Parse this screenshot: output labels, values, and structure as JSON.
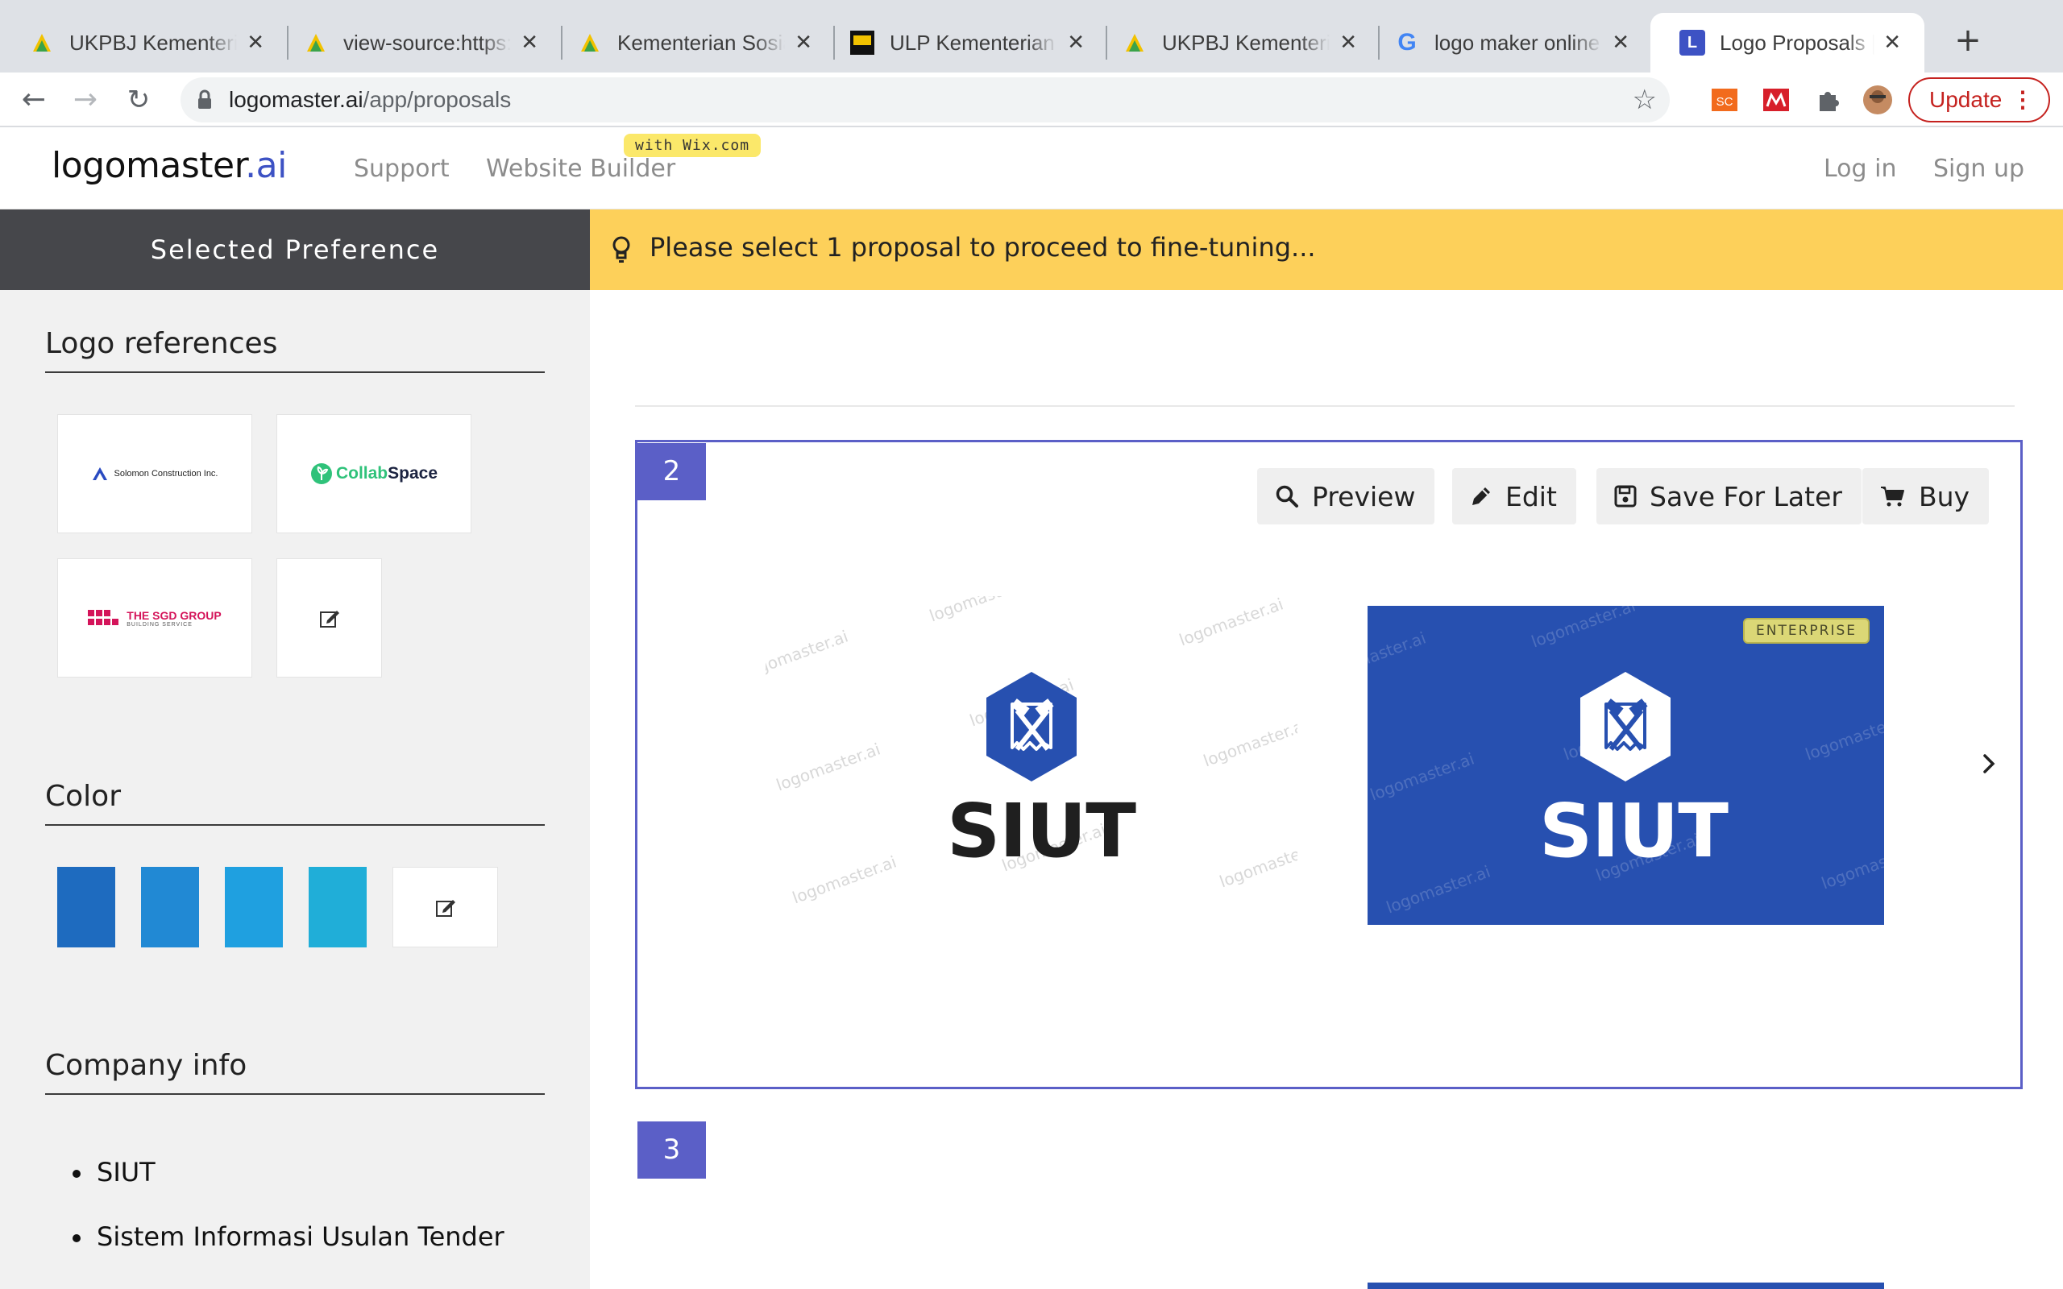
{
  "browser": {
    "tabs": [
      {
        "title": "UKPBJ Kementerian Sosial",
        "favicon": "kemensos-icon"
      },
      {
        "title": "view-source:https://",
        "favicon": "kemensos-icon"
      },
      {
        "title": "Kementerian Sosial",
        "favicon": "kemensos-icon"
      },
      {
        "title": "ULP Kementerian Sosial",
        "favicon": "ulp-icon"
      },
      {
        "title": "UKPBJ Kementerian Sosial",
        "favicon": "kemensos-icon"
      },
      {
        "title": "logo maker online",
        "favicon": "google-icon"
      },
      {
        "title": "Logo Proposals | Logomaster",
        "favicon": "logomaster-icon",
        "active": true
      }
    ],
    "url_host": "logomaster.ai",
    "url_path": "/app/proposals",
    "update_label": "Update"
  },
  "site": {
    "logo_main": "logomaster",
    "logo_suffix": ".ai",
    "nav": {
      "support": "Support",
      "website_builder": "Website Builder",
      "wix_badge": "with Wix.com"
    },
    "login": "Log in",
    "signup": "Sign up"
  },
  "sidebar": {
    "header": "Selected Preference",
    "logo_refs_title": "Logo references",
    "refs": [
      {
        "name": "Solomon Construction Inc."
      },
      {
        "name_a": "Collab",
        "name_b": "Space"
      },
      {
        "name": "THE SGD GROUP",
        "sub": "BUILDING SERVICE"
      }
    ],
    "color_title": "Color",
    "colors": [
      "#1e6bbf",
      "#2189d4",
      "#1fa0e0",
      "#20aed8"
    ],
    "company_title": "Company info",
    "company_info": [
      "SIUT",
      "Sistem Informasi Usulan Tender"
    ]
  },
  "banner": {
    "message": "Please select 1 proposal to proceed to fine-tuning..."
  },
  "proposals": [
    {
      "number": "2",
      "actions": {
        "preview": "Preview",
        "edit": "Edit",
        "save": "Save For Later",
        "buy": "Buy"
      },
      "brand_name": "SIUT",
      "badge": "ENTERPRISE",
      "watermark": "logomaster.ai"
    },
    {
      "number": "3"
    }
  ],
  "colors": {
    "accent": "#5b5fc7",
    "banner": "#fdd05a",
    "sidebar_head": "#46474b",
    "logo_blue": "#2750b0"
  }
}
